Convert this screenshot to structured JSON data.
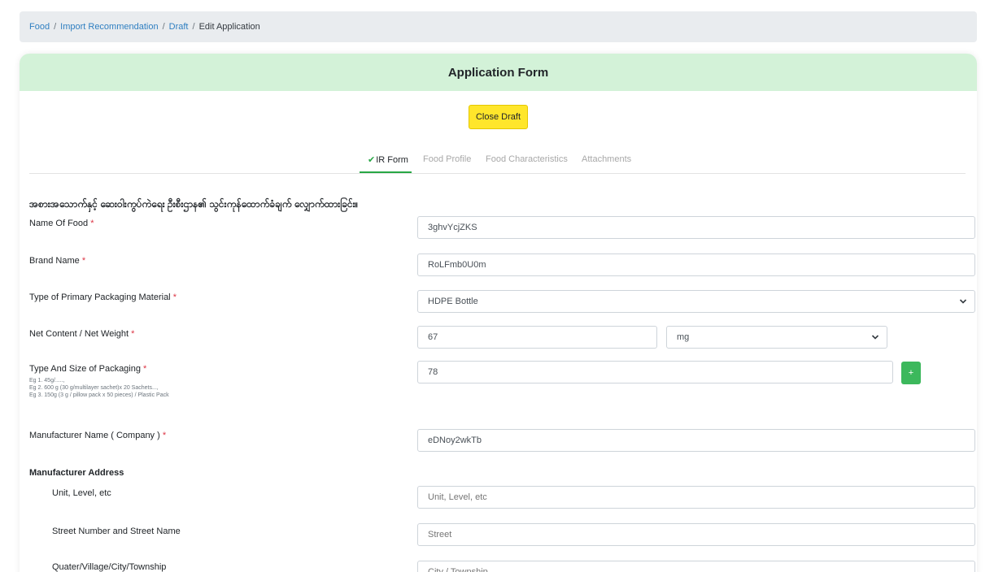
{
  "breadcrumb": {
    "items": [
      "Food",
      "Import Recommendation",
      "Draft"
    ],
    "current": "Edit Application",
    "separator": "/"
  },
  "header": {
    "title": "Application Form"
  },
  "close_draft_label": "Close Draft",
  "tabs": [
    {
      "label": "IR Form",
      "active": true,
      "icon": "check-icon"
    },
    {
      "label": "Food Profile",
      "active": false
    },
    {
      "label": "Food Characteristics",
      "active": false
    },
    {
      "label": "Attachments",
      "active": false
    }
  ],
  "form": {
    "section_title": "အစားအသောက်နှင့် ဆေးဝါးကွပ်ကဲရေး ဦးစီးဌာန၏ သွင်းကုန်ထောက်ခံချက် လျှောက်ထားခြင်း။",
    "required_mark": "*",
    "name_of_food": {
      "label": "Name Of Food",
      "value": "3ghvYcjZKS"
    },
    "brand_name": {
      "label": "Brand Name",
      "value": "RoLFmb0U0m"
    },
    "packaging_material": {
      "label": "Type of Primary Packaging Material",
      "value": "HDPE Bottle"
    },
    "net_content": {
      "label": "Net Content / Net Weight",
      "value": "67",
      "unit": "mg"
    },
    "packaging_size": {
      "label": "Type And Size of Packaging",
      "hints": [
        "Eg 1. 45g/.....,",
        "Eg 2. 600 g (30 g/multilayer sachet)x 20 Sachets...,",
        "Eg 3. 150g (3 g / pillow pack x 50 pieces) / Plastic Pack"
      ],
      "value": "78",
      "add_label": "+"
    },
    "manufacturer_name": {
      "label": "Manufacturer Name ( Company )",
      "value": "eDNoy2wkTb"
    },
    "manufacturer_address": {
      "heading": "Manufacturer Address",
      "unit": {
        "label": "Unit, Level, etc",
        "placeholder": "Unit, Level, etc"
      },
      "street": {
        "label": "Street Number and Street Name",
        "placeholder": "Street"
      },
      "city": {
        "label": "Quater/Village/City/Township",
        "placeholder": "City / Township"
      }
    }
  },
  "colors": {
    "header_bg": "#d3f2d8",
    "close_draft_bg": "#ffe62b",
    "link": "#2f7fc1",
    "required": "#dc3545",
    "active_tab": "#28a745",
    "plus_button": "#3cb85c"
  }
}
